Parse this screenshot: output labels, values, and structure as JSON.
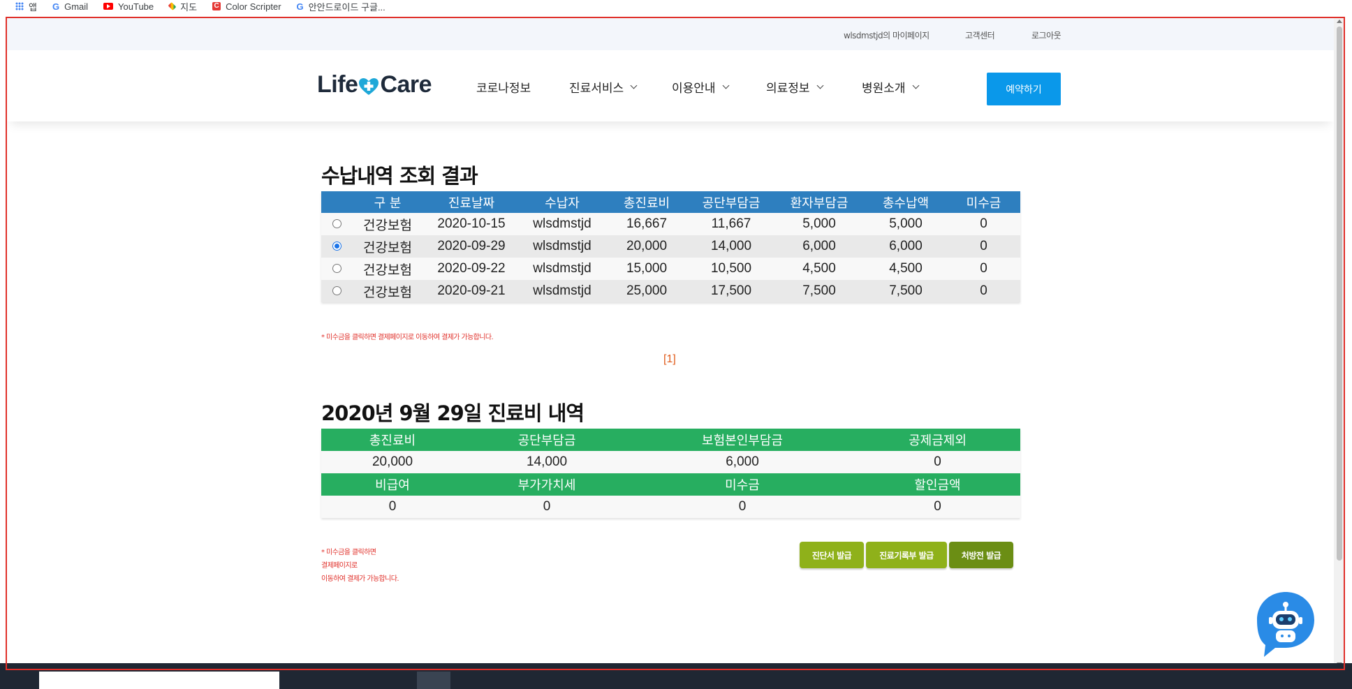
{
  "bookmarks": [
    {
      "label": "앱",
      "icon": "apps-grid-icon"
    },
    {
      "label": "Gmail",
      "icon": "google-icon"
    },
    {
      "label": "YouTube",
      "icon": "youtube-icon"
    },
    {
      "label": "지도",
      "icon": "maps-pin-icon"
    },
    {
      "label": "Color Scripter",
      "icon": "color-scripter-icon"
    },
    {
      "label": "안안드로이드 구글...",
      "icon": "google-icon"
    }
  ],
  "topbar": {
    "mypage": "wlsdmstjd의 마이페이지",
    "support": "고객센터",
    "logout": "로그아웃"
  },
  "header": {
    "logo_left": "Life",
    "logo_right": "Care",
    "nav": [
      {
        "label": "코로나정보",
        "has_dropdown": false
      },
      {
        "label": "진료서비스",
        "has_dropdown": true
      },
      {
        "label": "이용안내",
        "has_dropdown": true
      },
      {
        "label": "의료정보",
        "has_dropdown": true
      },
      {
        "label": "병원소개",
        "has_dropdown": true
      }
    ],
    "reserve_button": "예약하기"
  },
  "payment": {
    "title": "수납내역 조회 결과",
    "columns": [
      "구 분",
      "진료날짜",
      "수납자",
      "총진료비",
      "공단부담금",
      "환자부담금",
      "총수납액",
      "미수금"
    ],
    "rows": [
      {
        "selected": false,
        "type": "건강보험",
        "date": "2020-10-15",
        "payer": "wlsdmstjd",
        "total": "16,667",
        "nhis": "11,667",
        "patient": "5,000",
        "paid": "5,000",
        "unpaid": "0"
      },
      {
        "selected": true,
        "type": "건강보험",
        "date": "2020-09-29",
        "payer": "wlsdmstjd",
        "total": "20,000",
        "nhis": "14,000",
        "patient": "6,000",
        "paid": "6,000",
        "unpaid": "0"
      },
      {
        "selected": false,
        "type": "건강보험",
        "date": "2020-09-22",
        "payer": "wlsdmstjd",
        "total": "15,000",
        "nhis": "10,500",
        "patient": "4,500",
        "paid": "4,500",
        "unpaid": "0"
      },
      {
        "selected": false,
        "type": "건강보험",
        "date": "2020-09-21",
        "payer": "wlsdmstjd",
        "total": "25,000",
        "nhis": "17,500",
        "patient": "7,500",
        "paid": "7,500",
        "unpaid": "0"
      }
    ],
    "note": "* 미수금을 클릭하면 결제페이지로 이동하여 결제가 가능합니다.",
    "pager": "[1]"
  },
  "detail": {
    "title": "2020년 9월 29일 진료비 내역",
    "header1": [
      "총진료비",
      "공단부담금",
      "보험본인부담금",
      "공제금제외"
    ],
    "values1": [
      "20,000",
      "14,000",
      "6,000",
      "0"
    ],
    "header2": [
      "비급여",
      "부가가치세",
      "미수금",
      "할인금액"
    ],
    "values2": [
      "0",
      "0",
      "0",
      "0"
    ],
    "note_lines": [
      "* 미수금을 클릭하면",
      "결제페이지로",
      "이동하여 결제가 가능합니다."
    ],
    "buttons": [
      {
        "label": "진단서 발급",
        "color": "#8fb11a"
      },
      {
        "label": "진료기록부 발급",
        "color": "#8fb11a"
      },
      {
        "label": "처방전 발급",
        "color": "#6b8e14"
      }
    ]
  },
  "colors": {
    "payment_header": "#2e7fbf",
    "detail_header": "#27ae60",
    "reserve_button": "#0a98ea",
    "note_red": "#e0302a"
  },
  "chatbot": {
    "icon": "chatbot-robot-icon"
  }
}
